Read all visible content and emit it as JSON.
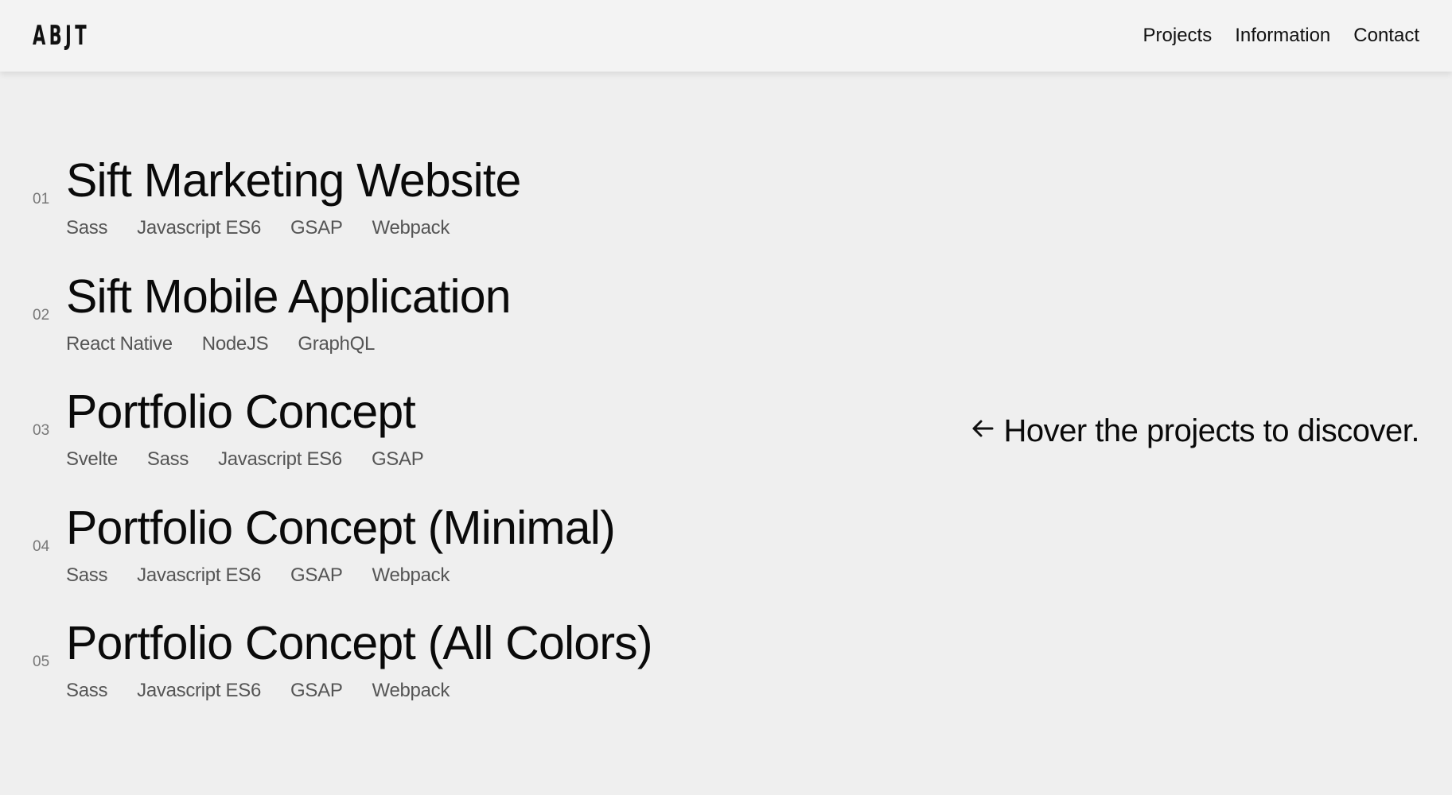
{
  "header": {
    "logo": "ABJT",
    "nav": [
      "Projects",
      "Information",
      "Contact"
    ]
  },
  "projects": [
    {
      "number": "01",
      "title": "Sift Marketing Website",
      "tags": [
        "Sass",
        "Javascript ES6",
        "GSAP",
        "Webpack"
      ]
    },
    {
      "number": "02",
      "title": "Sift Mobile Application",
      "tags": [
        "React Native",
        "NodeJS",
        "GraphQL"
      ]
    },
    {
      "number": "03",
      "title": "Portfolio Concept",
      "tags": [
        "Svelte",
        "Sass",
        "Javascript ES6",
        "GSAP"
      ]
    },
    {
      "number": "04",
      "title": "Portfolio Concept (Minimal)",
      "tags": [
        "Sass",
        "Javascript ES6",
        "GSAP",
        "Webpack"
      ]
    },
    {
      "number": "05",
      "title": "Portfolio Concept (All Colors)",
      "tags": [
        "Sass",
        "Javascript ES6",
        "GSAP",
        "Webpack"
      ]
    }
  ],
  "hint": {
    "icon": "arrow-left-icon",
    "text": "Hover the projects to discover."
  }
}
